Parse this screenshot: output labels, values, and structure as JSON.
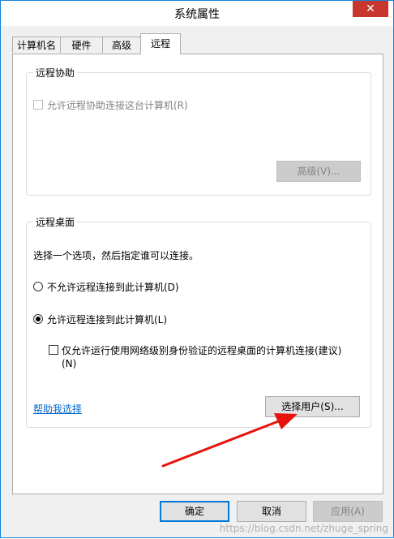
{
  "window": {
    "title": "系统属性",
    "close_glyph": "✕"
  },
  "tabs": [
    {
      "label": "计算机名",
      "active": false
    },
    {
      "label": "硬件",
      "active": false
    },
    {
      "label": "高级",
      "active": false
    },
    {
      "label": "远程",
      "active": true
    }
  ],
  "remote_assistance": {
    "title": "远程协助",
    "checkbox_label": "允许远程协助连接这台计算机(R)",
    "checked": false,
    "enabled": false,
    "advanced_button": "高级(V)..."
  },
  "remote_desktop": {
    "title": "远程桌面",
    "instruction": "选择一个选项，然后指定谁可以连接。",
    "option_deny": "不允许远程连接到此计算机(D)",
    "option_allow": "允许远程连接到此计算机(L)",
    "selected": "allow",
    "nla_label_line1": "仅允许运行使用网络级别身份验证的远程桌面的计算机连接(建议)",
    "nla_label_line2": "(N)",
    "nla_checked": false,
    "help_link": "帮助我选择",
    "select_users_button": "选择用户(S)..."
  },
  "footer": {
    "ok_button": "确定",
    "cancel_button": "取消",
    "apply_button": "应用(A)"
  },
  "annotation": {
    "arrow_color": "#e8120c"
  },
  "watermark": "https://blog.csdn.net/zhuge_spring"
}
